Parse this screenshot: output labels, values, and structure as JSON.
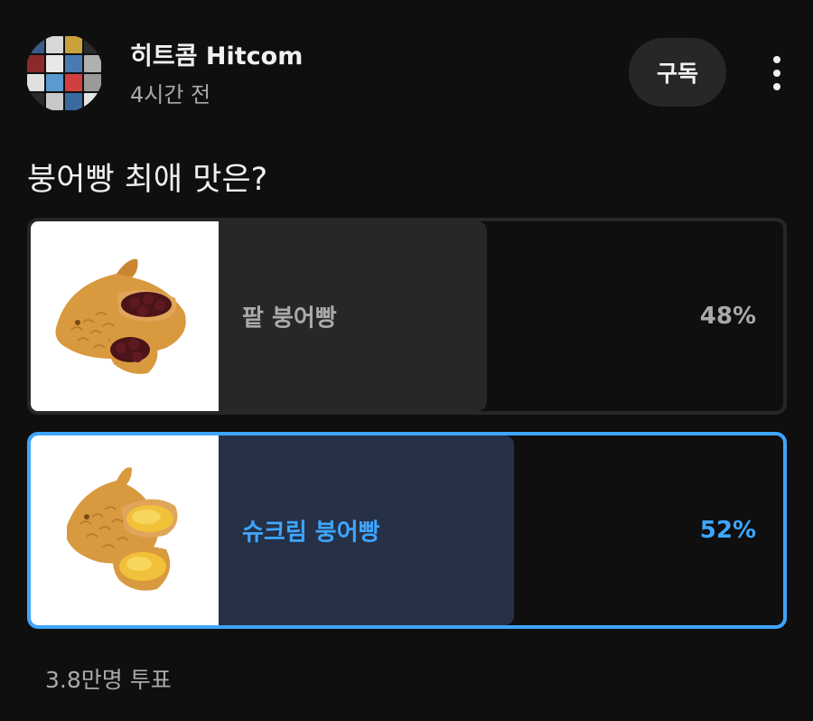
{
  "post": {
    "channel_name": "히트콤 Hitcom",
    "time": "4시간 전",
    "subscribe_label": "구독",
    "more_icon": "vertical-ellipsis-icon"
  },
  "poll": {
    "question": "붕어빵 최애 맛은?",
    "options": [
      {
        "label": "팥 붕어빵",
        "percent_text": "48%",
        "percent": 48,
        "selected": false,
        "image": "red-bean-bungeoppang-image"
      },
      {
        "label": "슈크림 붕어빵",
        "percent_text": "52%",
        "percent": 52,
        "selected": true,
        "image": "custard-cream-bungeoppang-image"
      }
    ],
    "vote_count": "3.8만명 투표"
  },
  "colors": {
    "background": "#0f0f0f",
    "accent_blue": "#3ea6ff",
    "muted_text": "#aaaaaa",
    "bar_unselected": "#272727",
    "bar_selected": "#263046"
  }
}
